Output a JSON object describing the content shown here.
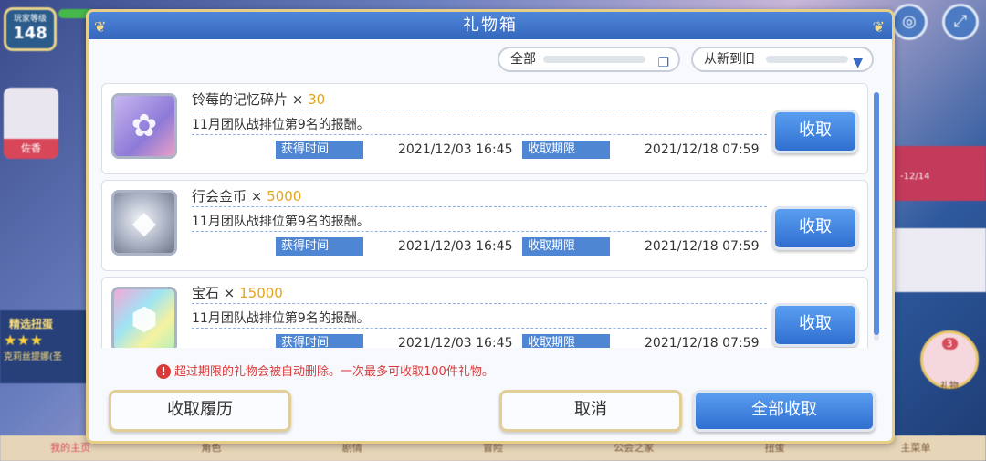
{
  "background": {
    "level_label": "玩家等级",
    "level_value": "148",
    "left_char_name": "佐香",
    "gacha_title": "精选扭蛋",
    "gacha_stars": "★★★",
    "gacha_sub": "克莉丝提娜(圣",
    "banner_date": "-12/14",
    "gift_count": "3",
    "gift_label": "礼物",
    "nav": [
      "我的主页",
      "角色",
      "剧情",
      "冒险",
      "公会之家",
      "扭蛋",
      "主菜单"
    ]
  },
  "dialog": {
    "title": "礼物箱",
    "filter_type": "全部",
    "sort_order": "从新到旧",
    "items": [
      {
        "name": "铃莓的记忆碎片 × ",
        "quantity": "30",
        "description": "11月团队战排位第9名的报酬。",
        "obtained_label": "获得时间",
        "obtained_time": "2021/12/03  16:45",
        "deadline_label": "收取期限",
        "deadline_time": "2021/12/18  07:59",
        "claim_label": "收取",
        "icon": "memory-piece-icon"
      },
      {
        "name": "行会金币 × ",
        "quantity": "5000",
        "description": "11月团队战排位第9名的报酬。",
        "obtained_label": "获得时间",
        "obtained_time": "2021/12/03  16:45",
        "deadline_label": "收取期限",
        "deadline_time": "2021/12/18  07:59",
        "claim_label": "收取",
        "icon": "guild-coin-icon"
      },
      {
        "name": "宝石 × ",
        "quantity": "15000",
        "description": "11月团队战排位第9名的报酬。",
        "obtained_label": "获得时间",
        "obtained_time": "2021/12/03  16:45",
        "deadline_label": "收取期限",
        "deadline_time": "2021/12/18  07:59",
        "claim_label": "收取",
        "icon": "jewel-icon"
      }
    ],
    "warning": "超过期限的礼物会被自动删除。一次最多可收取100件礼物。",
    "history_label": "收取履历",
    "cancel_label": "取消",
    "claim_all_label": "全部收取"
  },
  "colors": {
    "accent_blue": "#3a72cf",
    "quantity_gold": "#e3a51e",
    "warning_red": "#d93a3a",
    "frame_gold": "#e8cf88"
  }
}
